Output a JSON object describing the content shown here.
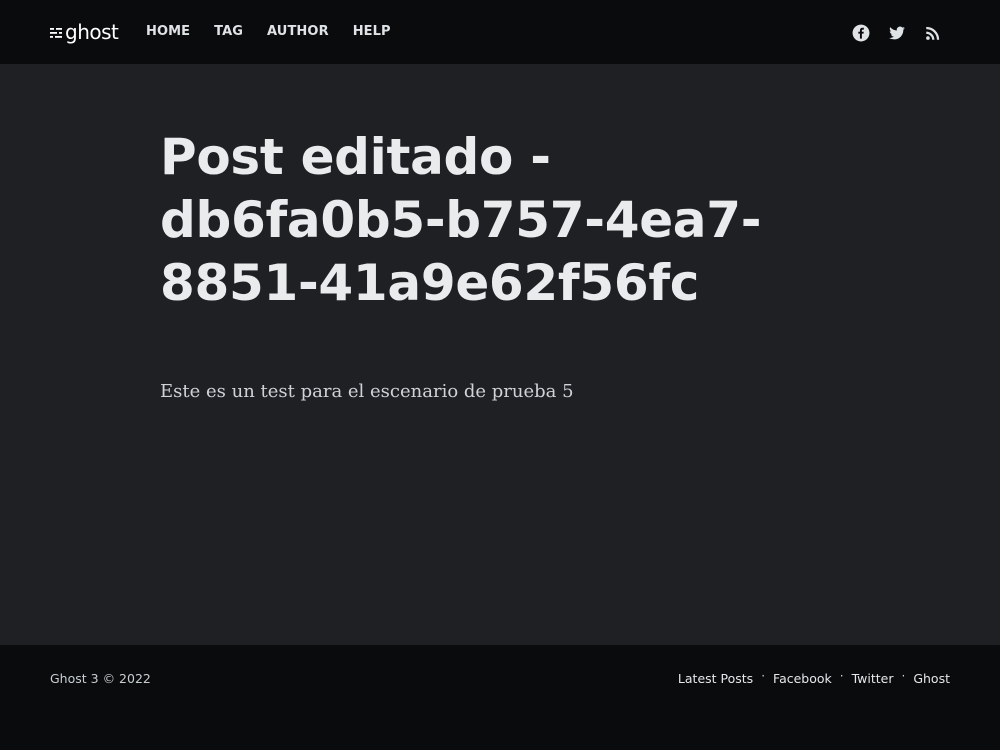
{
  "header": {
    "logo_text": "ghost",
    "nav": [
      {
        "label": "HOME"
      },
      {
        "label": "TAG"
      },
      {
        "label": "AUTHOR"
      },
      {
        "label": "HELP"
      }
    ],
    "social_icons": [
      "facebook-icon",
      "twitter-icon",
      "rss-icon"
    ]
  },
  "post": {
    "title": "Post editado - db6fa0b5-b757-4ea7-8851-41a9e62f56fc",
    "body": "Este es un test para el escenario de prueba 5"
  },
  "footer": {
    "copyright": "Ghost 3 © 2022",
    "links": [
      {
        "label": "Latest Posts"
      },
      {
        "label": "Facebook"
      },
      {
        "label": "Twitter"
      },
      {
        "label": "Ghost"
      }
    ],
    "separator": "·"
  },
  "colors": {
    "header_bg": "#0a0b0c",
    "main_bg": "#1f2024",
    "title_text": "#e9ebed",
    "body_text": "#cfd3d8"
  }
}
